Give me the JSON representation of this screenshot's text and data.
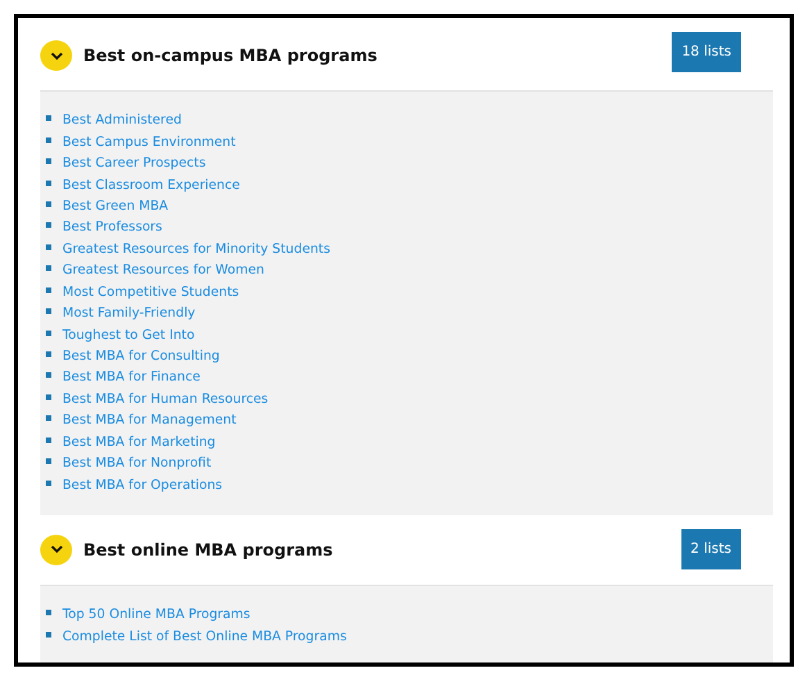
{
  "sections": [
    {
      "title": "Best on-campus MBA programs",
      "count": "18 lists",
      "expanded": true,
      "links": [
        "Best Administered",
        "Best Campus Environment",
        "Best Career Prospects",
        "Best Classroom Experience",
        "Best Green MBA",
        "Best Professors",
        "Greatest Resources for Minority Students",
        "Greatest Resources for Women",
        "Most Competitive Students",
        "Most Family-Friendly",
        "Toughest to Get Into",
        "Best MBA for Consulting",
        "Best MBA for Finance",
        "Best MBA for Human Resources",
        "Best MBA for Management",
        "Best MBA for Marketing",
        "Best MBA for Nonprofit",
        "Best MBA for Operations"
      ]
    },
    {
      "title": "Best online MBA programs",
      "count": "2 lists",
      "expanded": true,
      "links": [
        "Top 50 Online MBA Programs",
        "Complete List of Best Online MBA Programs"
      ]
    }
  ]
}
